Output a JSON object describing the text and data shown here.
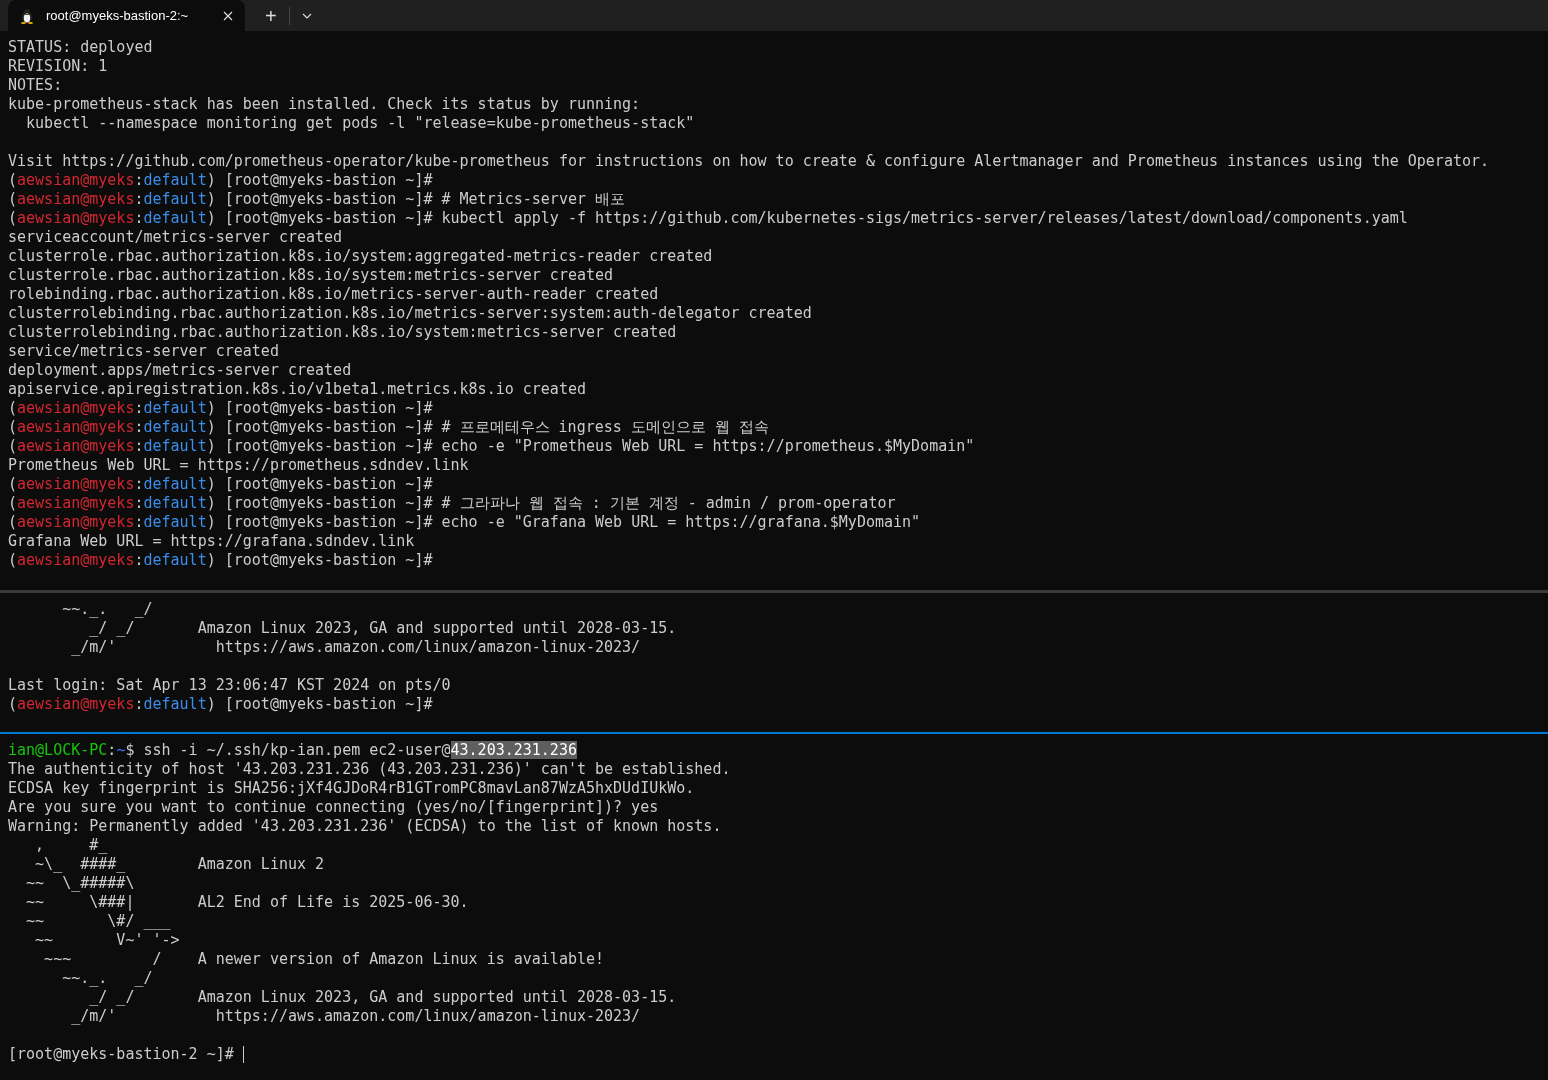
{
  "tabs": [
    {
      "title": "root@myeks-bastion-2:~",
      "selected": true
    }
  ],
  "tab_bar": {
    "new_tab": "+"
  },
  "panes": [
    {
      "focused": false,
      "blocks": [
        [
          {
            "segments": [
              {
                "text": "STATUS: deployed",
                "kind": "plain"
              }
            ]
          },
          {
            "segments": [
              {
                "text": "REVISION: 1",
                "kind": "plain"
              }
            ]
          },
          {
            "segments": [
              {
                "text": "NOTES:",
                "kind": "plain"
              }
            ]
          },
          {
            "segments": [
              {
                "text": "kube-prometheus-stack has been installed. Check its status by running:",
                "kind": "plain"
              }
            ]
          },
          {
            "segments": [
              {
                "text": "  kubectl --namespace monitoring get pods -l \"release=kube-prometheus-stack\"",
                "kind": "plain"
              }
            ]
          }
        ],
        [
          {
            "segments": [
              {
                "text": "Visit https://github.com/prometheus-operator/kube-prometheus for instructions on how to create & configure Alertmanager and Prometheus instances using the Operator.",
                "kind": "plain"
              }
            ]
          },
          {
            "segments": [
              {
                "text": "(",
                "kind": "plain"
              },
              {
                "text": "aewsian@myeks",
                "kind": "user"
              },
              {
                "text": ":",
                "kind": "plain"
              },
              {
                "text": "default",
                "kind": "context"
              },
              {
                "text": ") [root@myeks-bastion ~]#",
                "kind": "plain"
              }
            ]
          },
          {
            "segments": [
              {
                "text": "(",
                "kind": "plain"
              },
              {
                "text": "aewsian@myeks",
                "kind": "user"
              },
              {
                "text": ":",
                "kind": "plain"
              },
              {
                "text": "default",
                "kind": "context"
              },
              {
                "text": ") [root@myeks-bastion ~]# # Metrics-server 배포",
                "kind": "plain"
              }
            ]
          },
          {
            "segments": [
              {
                "text": "(",
                "kind": "plain"
              },
              {
                "text": "aewsian@myeks",
                "kind": "user"
              },
              {
                "text": ":",
                "kind": "plain"
              },
              {
                "text": "default",
                "kind": "context"
              },
              {
                "text": ") [root@myeks-bastion ~]# kubectl apply -f https://github.com/kubernetes-sigs/metrics-server/releases/latest/download/components.yaml",
                "kind": "plain"
              }
            ]
          },
          {
            "segments": [
              {
                "text": "serviceaccount/metrics-server created",
                "kind": "plain"
              }
            ]
          },
          {
            "segments": [
              {
                "text": "clusterrole.rbac.authorization.k8s.io/system:aggregated-metrics-reader created",
                "kind": "plain"
              }
            ]
          },
          {
            "segments": [
              {
                "text": "clusterrole.rbac.authorization.k8s.io/system:metrics-server created",
                "kind": "plain"
              }
            ]
          },
          {
            "segments": [
              {
                "text": "rolebinding.rbac.authorization.k8s.io/metrics-server-auth-reader created",
                "kind": "plain"
              }
            ]
          },
          {
            "segments": [
              {
                "text": "clusterrolebinding.rbac.authorization.k8s.io/metrics-server:system:auth-delegator created",
                "kind": "plain"
              }
            ]
          },
          {
            "segments": [
              {
                "text": "clusterrolebinding.rbac.authorization.k8s.io/system:metrics-server created",
                "kind": "plain"
              }
            ]
          },
          {
            "segments": [
              {
                "text": "service/metrics-server created",
                "kind": "plain"
              }
            ]
          },
          {
            "segments": [
              {
                "text": "deployment.apps/metrics-server created",
                "kind": "plain"
              }
            ]
          },
          {
            "segments": [
              {
                "text": "apiservice.apiregistration.k8s.io/v1beta1.metrics.k8s.io created",
                "kind": "plain"
              }
            ]
          },
          {
            "segments": [
              {
                "text": "(",
                "kind": "plain"
              },
              {
                "text": "aewsian@myeks",
                "kind": "user"
              },
              {
                "text": ":",
                "kind": "plain"
              },
              {
                "text": "default",
                "kind": "context"
              },
              {
                "text": ") [root@myeks-bastion ~]#",
                "kind": "plain"
              }
            ]
          },
          {
            "segments": [
              {
                "text": "(",
                "kind": "plain"
              },
              {
                "text": "aewsian@myeks",
                "kind": "user"
              },
              {
                "text": ":",
                "kind": "plain"
              },
              {
                "text": "default",
                "kind": "context"
              },
              {
                "text": ") [root@myeks-bastion ~]# # 프로메테우스 ingress 도메인으로 웹 접속",
                "kind": "plain"
              }
            ]
          },
          {
            "segments": [
              {
                "text": "(",
                "kind": "plain"
              },
              {
                "text": "aewsian@myeks",
                "kind": "user"
              },
              {
                "text": ":",
                "kind": "plain"
              },
              {
                "text": "default",
                "kind": "context"
              },
              {
                "text": ") [root@myeks-bastion ~]# echo -e \"Prometheus Web URL = https://prometheus.$MyDomain\"",
                "kind": "plain"
              }
            ]
          },
          {
            "segments": [
              {
                "text": "Prometheus Web URL = https://prometheus.sdndev.link",
                "kind": "plain"
              }
            ]
          },
          {
            "segments": [
              {
                "text": "(",
                "kind": "plain"
              },
              {
                "text": "aewsian@myeks",
                "kind": "user"
              },
              {
                "text": ":",
                "kind": "plain"
              },
              {
                "text": "default",
                "kind": "context"
              },
              {
                "text": ") [root@myeks-bastion ~]#",
                "kind": "plain"
              }
            ]
          },
          {
            "segments": [
              {
                "text": "(",
                "kind": "plain"
              },
              {
                "text": "aewsian@myeks",
                "kind": "user"
              },
              {
                "text": ":",
                "kind": "plain"
              },
              {
                "text": "default",
                "kind": "context"
              },
              {
                "text": ") [root@myeks-bastion ~]# # 그라파나 웹 접속 : 기본 계정 - admin / prom-operator",
                "kind": "plain"
              }
            ]
          },
          {
            "segments": [
              {
                "text": "(",
                "kind": "plain"
              },
              {
                "text": "aewsian@myeks",
                "kind": "user"
              },
              {
                "text": ":",
                "kind": "plain"
              },
              {
                "text": "default",
                "kind": "context"
              },
              {
                "text": ") [root@myeks-bastion ~]# echo -e \"Grafana Web URL = https://grafana.$MyDomain\"",
                "kind": "plain"
              }
            ]
          },
          {
            "segments": [
              {
                "text": "Grafana Web URL = https://grafana.sdndev.link",
                "kind": "plain"
              }
            ]
          },
          {
            "segments": [
              {
                "text": "(",
                "kind": "plain"
              },
              {
                "text": "aewsian@myeks",
                "kind": "user"
              },
              {
                "text": ":",
                "kind": "plain"
              },
              {
                "text": "default",
                "kind": "context"
              },
              {
                "text": ") [root@myeks-bastion ~]#",
                "kind": "plain"
              }
            ]
          }
        ]
      ]
    },
    {
      "focused": false,
      "blocks": [
        [
          {
            "segments": [
              {
                "text": "      ~~._.   _/",
                "kind": "plain"
              }
            ]
          },
          {
            "segments": [
              {
                "text": "         _/ _/       Amazon Linux 2023, GA and supported until 2028-03-15.",
                "kind": "plain"
              }
            ]
          },
          {
            "segments": [
              {
                "text": "       _/m/'           https://aws.amazon.com/linux/amazon-linux-2023/",
                "kind": "plain"
              }
            ]
          }
        ],
        [
          {
            "segments": [
              {
                "text": "Last login: Sat Apr 13 23:06:47 KST 2024 on pts/0",
                "kind": "plain"
              }
            ]
          },
          {
            "segments": [
              {
                "text": "(",
                "kind": "plain"
              },
              {
                "text": "aewsian@myeks",
                "kind": "user"
              },
              {
                "text": ":",
                "kind": "plain"
              },
              {
                "text": "default",
                "kind": "context"
              },
              {
                "text": ") [root@myeks-bastion ~]#",
                "kind": "plain"
              }
            ]
          }
        ]
      ]
    },
    {
      "focused": true,
      "blocks": [
        [
          {
            "segments": [
              {
                "text": "ian@LOCK-PC",
                "kind": "local-user"
              },
              {
                "text": ":",
                "kind": "plain"
              },
              {
                "text": "~",
                "kind": "local-path"
              },
              {
                "text": "$ ssh -i ~/.ssh/kp-ian.pem ec2-user@",
                "kind": "plain"
              },
              {
                "text": "43.203.231.236",
                "kind": "selection"
              }
            ]
          },
          {
            "segments": [
              {
                "text": "The authenticity of host '43.203.231.236 (43.203.231.236)' can't be established.",
                "kind": "plain"
              }
            ]
          },
          {
            "segments": [
              {
                "text": "ECDSA key fingerprint is SHA256:jXf4GJDoR4rB1GTromPC8mavLan87WzA5hxDUdIUkWo.",
                "kind": "plain"
              }
            ]
          },
          {
            "segments": [
              {
                "text": "Are you sure you want to continue connecting (yes/no/[fingerprint])? yes",
                "kind": "plain"
              }
            ]
          },
          {
            "segments": [
              {
                "text": "Warning: Permanently added '43.203.231.236' (ECDSA) to the list of known hosts.",
                "kind": "plain"
              }
            ]
          },
          {
            "segments": [
              {
                "text": "   ,     #_",
                "kind": "plain"
              }
            ]
          },
          {
            "segments": [
              {
                "text": "   ~\\_  ####_        Amazon Linux 2",
                "kind": "plain"
              }
            ]
          },
          {
            "segments": [
              {
                "text": "  ~~  \\_#####\\",
                "kind": "plain"
              }
            ]
          },
          {
            "segments": [
              {
                "text": "  ~~     \\###|       AL2 End of Life is 2025-06-30.",
                "kind": "plain"
              }
            ]
          },
          {
            "segments": [
              {
                "text": "  ~~       \\#/ ___",
                "kind": "plain"
              }
            ]
          },
          {
            "segments": [
              {
                "text": "   ~~       V~' '->",
                "kind": "plain"
              }
            ]
          },
          {
            "segments": [
              {
                "text": "    ~~~         /    A newer version of Amazon Linux is available!",
                "kind": "plain"
              }
            ]
          },
          {
            "segments": [
              {
                "text": "      ~~._.   _/",
                "kind": "plain"
              }
            ]
          },
          {
            "segments": [
              {
                "text": "         _/ _/       Amazon Linux 2023, GA and supported until 2028-03-15.",
                "kind": "plain"
              }
            ]
          },
          {
            "segments": [
              {
                "text": "       _/m/'           https://aws.amazon.com/linux/amazon-linux-2023/",
                "kind": "plain"
              }
            ]
          }
        ],
        [
          {
            "segments": [
              {
                "text": "[root@myeks-bastion-2 ~]# ",
                "kind": "plain"
              }
            ],
            "cursor": true
          }
        ]
      ]
    }
  ]
}
